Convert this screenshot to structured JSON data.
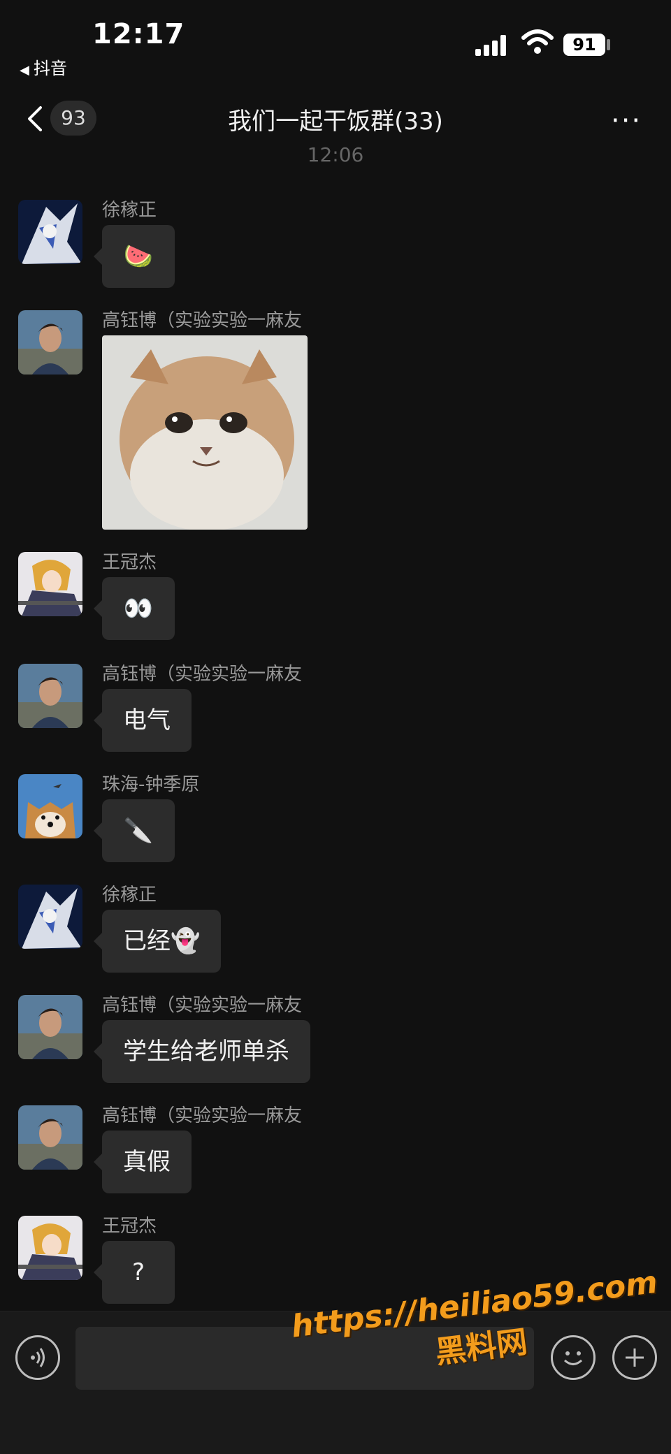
{
  "status": {
    "time": "12:17",
    "back_app": "抖音",
    "battery": "91"
  },
  "header": {
    "unread_count": "93",
    "title": "我们一起干饭群(33)",
    "more": "···"
  },
  "timestamp": "12:06",
  "messages": [
    {
      "sender": "徐稼正",
      "text": "🍉",
      "avatar": "anime-white-hair"
    },
    {
      "sender": "高钰博（实验实验一麻友",
      "image": "crying-kitten",
      "avatar": "man-portrait"
    },
    {
      "sender": "王冠杰",
      "text": "👀",
      "avatar": "anime-blonde"
    },
    {
      "sender": "高钰博（实验实验一麻友",
      "text": "电气",
      "avatar": "man-portrait"
    },
    {
      "sender": "珠海-钟季原",
      "text": "🔪",
      "avatar": "shiba-dog"
    },
    {
      "sender": "徐稼正",
      "text": "已经👻",
      "avatar": "anime-white-hair"
    },
    {
      "sender": "高钰博（实验实验一麻友",
      "text": "学生给老师单杀",
      "avatar": "man-portrait"
    },
    {
      "sender": "高钰博（实验实验一麻友",
      "text": "真假",
      "avatar": "man-portrait"
    },
    {
      "sender": "王冠杰",
      "text": "?",
      "avatar": "anime-blonde"
    }
  ],
  "watermark": {
    "line1": "https://heiliao59.com",
    "line2": "黑料网"
  }
}
